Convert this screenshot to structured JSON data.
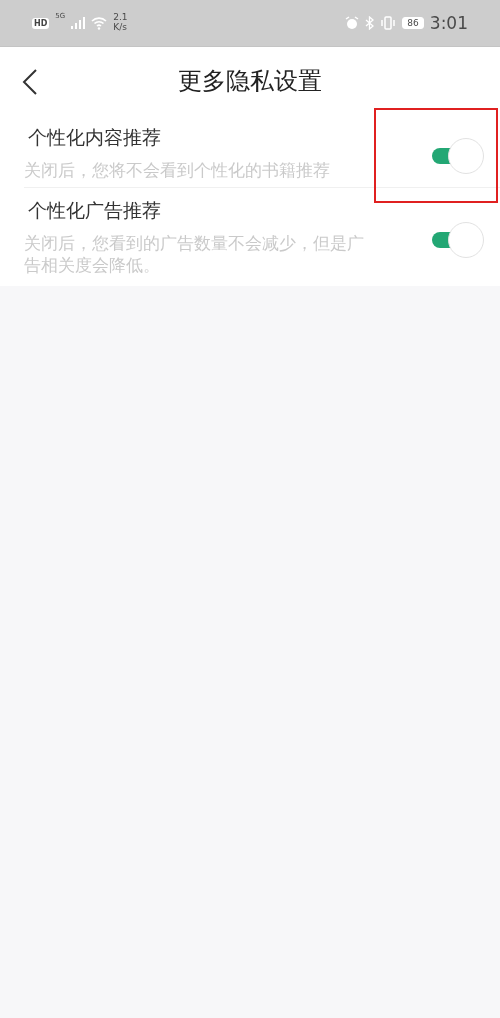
{
  "status_bar": {
    "hd": "HD",
    "network": "5G",
    "speed_value": "2.1",
    "speed_unit": "K/s",
    "battery": "86",
    "time": "3:01"
  },
  "header": {
    "title": "更多隐私设置"
  },
  "settings": [
    {
      "title": "个性化内容推荐",
      "description": "关闭后，您将不会看到个性化的书籍推荐",
      "on": true,
      "highlighted": true
    },
    {
      "title": "个性化广告推荐",
      "description": "关闭后，您看到的广告数量不会减少，但是广告相关度会降低。",
      "on": true,
      "highlighted": false
    }
  ]
}
